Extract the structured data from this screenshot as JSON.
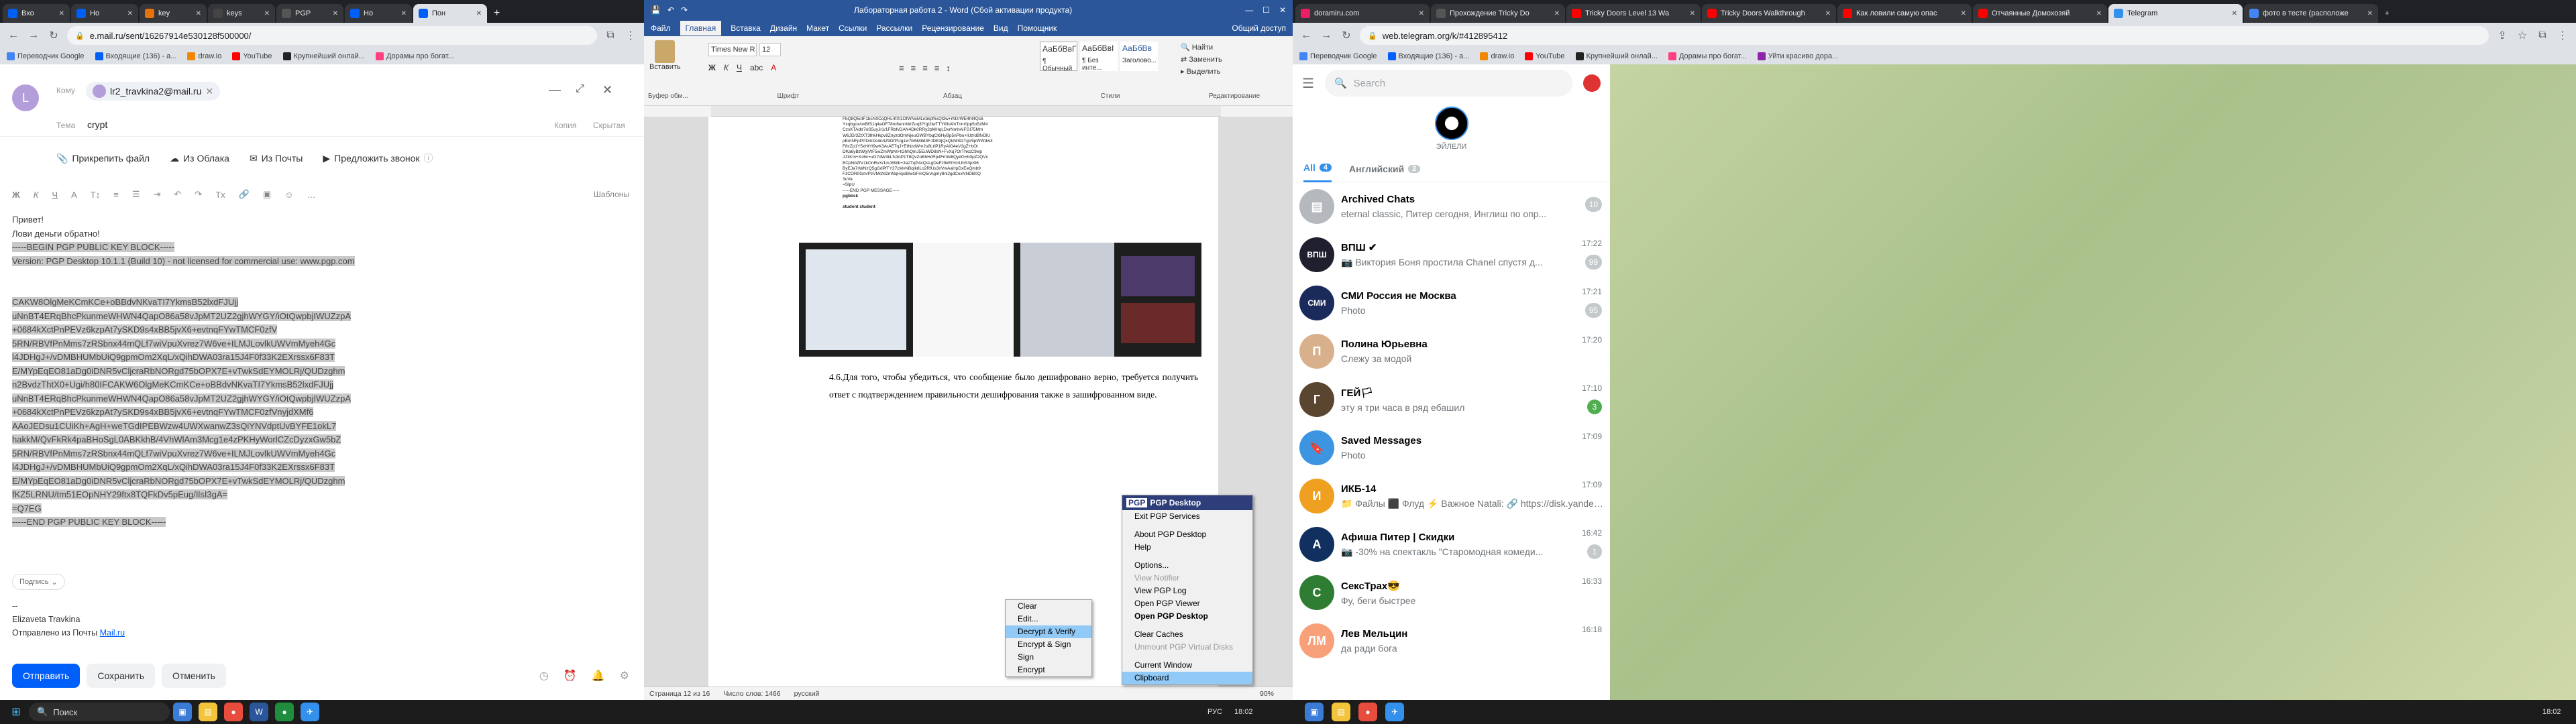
{
  "browser1": {
    "tabs": [
      "Вхо",
      "Но",
      "key",
      "keys",
      "PGP",
      "Ho",
      "Пон"
    ],
    "active_tab_index": 6,
    "url": "e.mail.ru/sent/16267914e530128f500000/",
    "bookmarks": [
      "Переводчик Google",
      "Входящие (136) - a...",
      "draw.io",
      "YouTube",
      "Крупнейший онлай...",
      "Дорамы про богат..."
    ]
  },
  "mail": {
    "window_title": "Кому",
    "from_label": "Кому",
    "recipient_initial": "L",
    "recipient_chip": "lr2_travkina2@mail.ru",
    "subject_label": "Тема",
    "subject_value": "crypt",
    "copy_link": "Копия",
    "hidden_copy_link": "Скрытая",
    "attach_file": "Прикрепить файл",
    "from_cloud": "Из Облака",
    "from_mail": "Из Почты",
    "offer_call": "Предложить звонок",
    "templates": "Шаблоны",
    "greeting": "Привет!",
    "greeting2": "Лови деньги обратно!",
    "pgp_lines": [
      "-----BEGIN PGP PUBLIC KEY BLOCK-----",
      "Version: PGP Desktop 10.1.1 (Build 10) - not licensed for commercial use: www.pgp.com",
      "",
      "",
      "CAKW8OlgMeKCmKCe+oBBdvNKvaTI7YkmsB52lxdFJUjj",
      "uNnBT4ERqBhcPkunmeWHWN4QapO86a58vJpMT2UZ2gjhWYGY/iOtQwpbjIWUZzpA",
      "+0684kXctPnPEVz6kzpAt7ySKD9s4xBB5jvX6+evtnqFYwTMCF0zfV",
      "5RN/RBVfPnMms7zRSbnx44mQLf7wiVpuXvrez7W6ve+ILMJLovlkUWVmMyeh4Gc",
      "l4JDHgJ+/vDMBHUMbUiQ9gpmOm2XqL/xQihDWA03ra15J4F0f33K2EXrssx6F83T",
      "E/MYpEqEO81aDg0iDNR5vCljcraRbNORgd75bOPX7E+vTwkSdEYMOLRj/QUDzghm",
      "n2BvdzThtX0+Ugi/h80IFCAKW6OlgMeKCmKCe+oBBdvNKvaTI7YkmsB52lxdFJUjj",
      "uNnBT4ERqBhcPkunmeWHWN4QapO86a58vJpMT2UZ2gjhWYGY/iOtQwpbjIWUZzpA",
      "+0684kXctPnPEVz6kzpAt7ySKD9s4xBB5jvX6+evtnqFYwTMCF0zfVnyjdXMf6",
      "AAoJEDsu1CUiKh+AgH+weTGdIPEBWzw4UWXwanwZ3sQiYNVdptUvBYFE1okL7",
      "hakkM/QvFkRk4paBHoSgL0ABKkhB/4VhWlAm3Mcg1e4zPKHyWorlCZcDyzxGw5bZ",
      "5RN/RBVfPnMms7zRSbnx44mQLf7wiVpuXvrez7W6ve+ILMJLovlkUWVmMyeh4Gc",
      "l4JDHgJ+/vDMBHUMbUiQ9gpmOm2XqL/xQihDWA03ra15J4F0f33K2EXrssx6F83T",
      "E/MYpEqEO81aDg0iDNR5vCljcraRbNORgd75bOPX7E+vTwkSdEYMOLRj/QUDzghm",
      "fKZ5LRNU/tm51EOpNHY29ftx8TQFkDv5pEug/IlsI3gA=",
      "=Q7EG",
      "-----END PGP PUBLIC KEY BLOCK-----"
    ],
    "signature_chip": "Подпись",
    "sig_dash": "--",
    "sig_name": "Elizaveta Travkina",
    "sig_sent": "Отправлено из Почты ",
    "sig_link": "Mail.ru",
    "send": "Отправить",
    "save": "Сохранить",
    "cancel": "Отменить"
  },
  "word": {
    "title": "Лабораторная работа 2 - Word (Сбой активации продукта)",
    "tabs": [
      "Файл",
      "Главная",
      "Вставка",
      "Дизайн",
      "Макет",
      "Ссылки",
      "Рассылки",
      "Рецензирование",
      "Вид",
      "Помощник",
      "Общий доступ"
    ],
    "active_tab_index": 1,
    "paste": "Вставить",
    "font_name": "Times New R",
    "font_size": "12",
    "styles": [
      "АаБбВвГ",
      "АаБбВвI",
      "АаБбВв"
    ],
    "style_names": [
      "¶ Обычный",
      "¶ Без инте...",
      "Заголово..."
    ],
    "find": "Найти",
    "replace": "Заменить",
    "select": "Выделить",
    "groups": [
      "Буфер обм...",
      "Шрифт",
      "Абзац",
      "Стили",
      "Редактирование"
    ],
    "doc_small_lines": [
      "FbQ8Q5otF1bsN0CqQHL4fXl1OfWNeMLnbkpfhxQt3w+rMzrWE4ht4Qc6",
      "Yxqbgox/vxBfS1q4aOF78n/8ennWrZoq3fYgi2lwTTYl0bAfnTnm0pp5o5zM4",
      "CzsKTAdtr7oS5uyJr1/1FRbfvDAN4Dk0RRy2pMHqLDvrNmhAiFGI75Mm",
      "W6JD/3ZtXT3thkHkpv8ZnyzdOmNjeuGWBYbqCt6HyBp5nPbo+lUz/dBfvDlU",
      "pEmNFpPPDmDcdn/tZ9GfPUg1w7bl5M8d3FJDE3jQxQkNh9zTgV5pWWdw3",
      "F8cZp1Y5xHtYl9wK3ArAE7qJ+EtNzdWm2s8Lt/P1RyAiO4eV2gZ+bOi",
      "DKa6yBzWjyVtF5wZmWpNt+tGhhQmJ5EuWD8sN+FvXq7OrThkcC9wp",
      "JJ1Km+Xz6c+uG7dW4kLfs3nP1T8QvZoBhHcRp4FmW8QydG+b0pZ2QVc",
      "BCpNbZfV1kOnRvX/1mJ8Wb+3a2TqP4cQsLgDeFz9kEtYmUhS3pXl6",
      "ByEJa7rWNzQ5gGdPfTY27cMvNBqIk8Lo2RfUs3nVwAaHpDxEeQmb9",
      "FzCOR0Gm/PzVMcNl2mNqHqsl8lwGFmQ5nAgmy8nl2gdCexNNDB0Q",
      "3uVa",
      "=SlpU",
      "-----END PGP MESSAGE-----",
      "pgbbsk",
      "",
      "student student"
    ],
    "paragraph_num": "4.6.",
    "paragraph": "Для того, чтобы убедиться, что сообщение было дешифровано верно, требуется получить ответ с подтверждением правильности дешифрования также в зашифрованном виде.",
    "page_number": "12",
    "status_page": "Страница 12 из 16",
    "status_words": "Число слов: 1466",
    "status_lang": "русский",
    "zoom": "90%",
    "ctx_main": [
      "Clear",
      "Edit...",
      "Decrypt & Verify",
      "Encrypt & Sign",
      "Sign",
      "Encrypt"
    ],
    "ctx_pgp_header": "PGP Desktop",
    "ctx_pgp": [
      "Exit PGP Services",
      "About PGP Desktop",
      "Help",
      "Options...",
      "View Notifier",
      "View PGP Log",
      "Open PGP Viewer",
      "Open PGP Desktop",
      "Clear Caches",
      "Unmount PGP Virtual Disks",
      "Current Window",
      "Clipboard"
    ]
  },
  "browser2": {
    "tabs": [
      "doramiru.com",
      "Прохождение Tricky Do",
      "Tricky Doors Level 13 Wa",
      "Tricky Doors Walkthrough",
      "Как ловили самую опас",
      "Отчаянные Домохозяй",
      "Telegram",
      "фото в тесте (расположе"
    ],
    "active_tab_index": 6,
    "url": "web.telegram.org/k/#412895412",
    "bookmarks": [
      "Переводчик Google",
      "Входящие (136) - a...",
      "draw.io",
      "YouTube",
      "Крупнейший онлай...",
      "Дорамы про богат...",
      "Уйти красиво дорa..."
    ]
  },
  "telegram": {
    "search_placeholder": "Search",
    "story_label": "ЭЙЛЕЛИ",
    "folders": [
      {
        "label": "All",
        "count": "4"
      },
      {
        "label": "Английский",
        "count": "2"
      }
    ],
    "chats": [
      {
        "title": "Archived Chats",
        "preview": "eternal classic, Питер сегодня, Инглиш по опр...",
        "time": "",
        "badge": "10",
        "color": "#b5b9bd",
        "initial": "▤"
      },
      {
        "title": "ВПШ ✔",
        "preview": "📷 Виктория Боня простила Chanel спустя д...",
        "time": "17:22",
        "badge": "99",
        "color": "#1f1f2e",
        "initial": "ВПШ"
      },
      {
        "title": "СМИ Россия не Москва",
        "preview": "Photo",
        "time": "17:21",
        "badge": "95",
        "color": "#1a2a5a",
        "initial": "СМИ"
      },
      {
        "title": "Полина Юрьевна",
        "preview": "Слежу за модой",
        "time": "17:20",
        "badge": "",
        "color": "#d8b08c",
        "initial": "П"
      },
      {
        "title": "ГЕЙ🏳",
        "preview": "эту я три часа в ряд ебашил",
        "time": "17:10",
        "badge": "3",
        "color": "#5a4630",
        "initial": "Г"
      },
      {
        "title": "Saved Messages",
        "preview": "Photo",
        "time": "17:09",
        "badge": "",
        "color": "#3d95e2",
        "initial": "🔖"
      },
      {
        "title": "ИКБ-14",
        "preview": "📁 Файлы ⬛ Флуд ⚡ Важное  Natali: 🔗 https://disk.yandex.ru/d/rYTj5Dp0HElG...",
        "time": "17:09",
        "badge": "",
        "color": "#f0a020",
        "initial": "И"
      },
      {
        "title": "Афиша Питер | Скидки",
        "preview": "📷 -30% на спектакль \"Старомодная комеди...",
        "time": "16:42",
        "badge": "1",
        "color": "#113060",
        "initial": "А"
      },
      {
        "title": "СексТрах😎",
        "preview": "Фу, беги быстрее",
        "time": "16:33",
        "badge": "",
        "color": "#2e7d32",
        "initial": "С"
      },
      {
        "title": "Лев Мельцин",
        "preview": "да ради бога",
        "time": "16:18",
        "badge": "",
        "color": "#f7a07a",
        "initial": "ЛМ"
      }
    ]
  },
  "taskbar": {
    "search": "Поиск",
    "lang": "РУС",
    "time_left": "18:02",
    "time_right": "18:02"
  },
  "colors": {
    "mail_blue": "#005ff9",
    "word_blue": "#2b579a",
    "tg_blue": "#3390ec",
    "selection_gray": "#c8c8c8"
  }
}
